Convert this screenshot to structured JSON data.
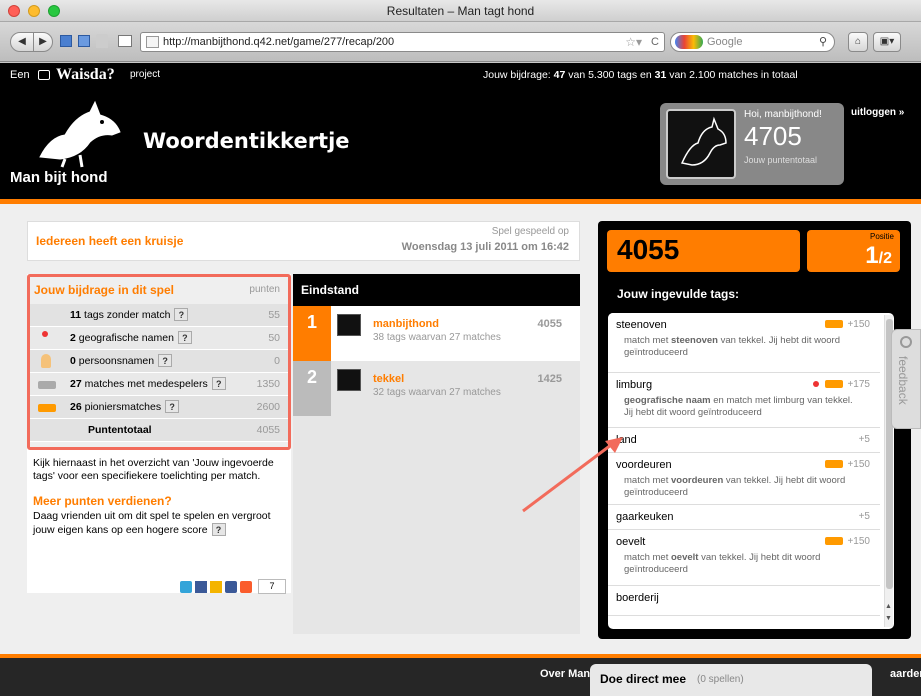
{
  "window": {
    "title": "Resultaten – Man tagt hond"
  },
  "browser": {
    "url": "http://manbijthond.q42.net/game/277/recap/200",
    "search_placeholder": "Google"
  },
  "topstrip": {
    "prefix": "Een",
    "brand": "Waisda?",
    "suffix": "project",
    "contribution_prefix": "Jouw bijdrage:",
    "tags_count": "47",
    "tags_total_text": "van 5.300 tags en",
    "matches_count": "31",
    "matches_total_text": "van 2.100 matches in totaal"
  },
  "header": {
    "logo_text": "Man bijt hond",
    "game_title": "Woordentikkertje",
    "greeting": "Hoi, manbijthond!",
    "score": "4705",
    "score_label": "Jouw puntentotaal",
    "logout": "uitloggen »"
  },
  "notice": {
    "text": "Iedereen heeft een kruisje",
    "played_label": "Spel gespeeld op",
    "played_date": "Woensdag 13 juli 2011 om 16:42"
  },
  "contribution": {
    "title": "Jouw bijdrage in dit spel",
    "points_header": "punten",
    "rows": [
      {
        "count": "11",
        "label": "tags zonder match",
        "points": "55"
      },
      {
        "count": "2",
        "label": "geografische namen",
        "points": "50"
      },
      {
        "count": "0",
        "label": "persoonsnamen",
        "points": "0"
      },
      {
        "count": "27",
        "label": "matches met medespelers",
        "points": "1350"
      },
      {
        "count": "26",
        "label": "pioniersmatches",
        "points": "2600"
      }
    ],
    "total_label": "Puntentotaal",
    "total_points": "4055",
    "explain": "Kijk hiernaast in het overzicht van 'Jouw ingevoerde tags' voor een specifiekere toelichting per match.",
    "more_title": "Meer punten verdienen?",
    "more_text": "Daag vrienden uit om dit spel te spelen en vergroot jouw eigen kans op een hogere score",
    "share_count": "7"
  },
  "standings": {
    "title": "Eindstand",
    "players": [
      {
        "rank": "1",
        "name": "manbijthond",
        "detail": "38 tags waarvan 27 matches",
        "score": "4055"
      },
      {
        "rank": "2",
        "name": "tekkel",
        "detail": "32 tags waarvan 27 matches",
        "score": "1425"
      }
    ]
  },
  "result": {
    "score": "4055",
    "position_label": "Positie",
    "position": "1",
    "position_of": "/2",
    "tags_title": "Jouw ingevulde tags:"
  },
  "tags": [
    {
      "name": "steenoven",
      "points": "+150",
      "desc_pre": "match met",
      "desc_bold": "steenoven",
      "desc_post": "van tekkel. Jij hebt dit woord geïntroduceerd"
    },
    {
      "name": "limburg",
      "points": "+175",
      "desc_pre": "",
      "desc_bold": "geografische naam",
      "desc_post": "en match met limburg van tekkel. Jij hebt dit woord geïntroduceerd"
    },
    {
      "name": "land",
      "points": "+5",
      "desc_pre": "",
      "desc_bold": "",
      "desc_post": ""
    },
    {
      "name": "voordeuren",
      "points": "+150",
      "desc_pre": "match met",
      "desc_bold": "voordeuren",
      "desc_post": "van tekkel. Jij hebt dit woord geïntroduceerd"
    },
    {
      "name": "gaarkeuken",
      "points": "+5",
      "desc_pre": "",
      "desc_bold": "",
      "desc_post": ""
    },
    {
      "name": "oevelt",
      "points": "+150",
      "desc_pre": "match met",
      "desc_bold": "oevelt",
      "desc_post": "van tekkel. Jij hebt dit woord geïntroduceerd"
    },
    {
      "name": "boerderij",
      "points": "",
      "desc_pre": "",
      "desc_bold": "",
      "desc_post": ""
    }
  ],
  "feedback": "feedback",
  "footer": {
    "left_text": "Over Man",
    "right_text": "aarden",
    "popup_title": "Doe direct mee",
    "popup_sub": "(0 spellen)"
  },
  "colors": {
    "accent": "#ff7d00",
    "highlight": "#f26b5b"
  }
}
